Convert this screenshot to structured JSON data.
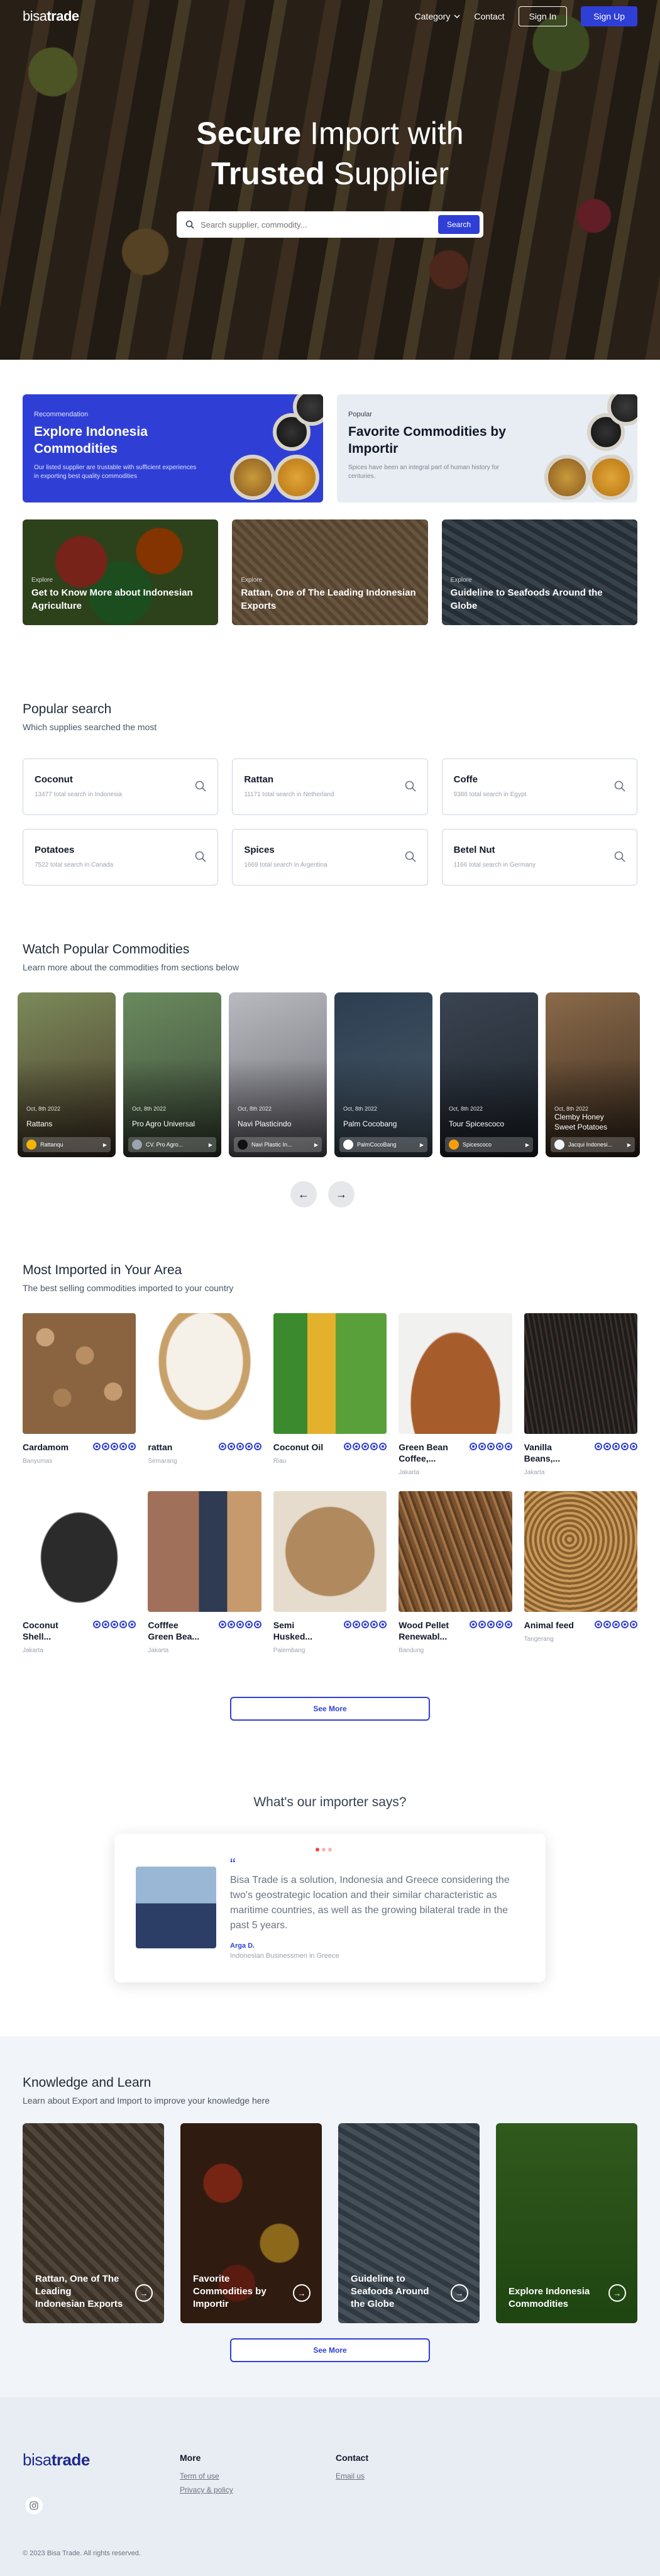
{
  "nav": {
    "logo_part1": "bisa",
    "logo_part2": "trade",
    "category": "Category",
    "contact": "Contact",
    "sign_in": "Sign In",
    "sign_up": "Sign Up"
  },
  "hero": {
    "title_bold1": "Secure",
    "title_rest1": " Import with",
    "title_bold2": "Trusted",
    "title_rest2": " Supplier",
    "search_placeholder": "Search supplier, commodity...",
    "search_button": "Search"
  },
  "promo": [
    {
      "tag": "Recommendation",
      "title": "Explore Indonesia Commodities",
      "desc": "Our listed supplier are trustable with sufficient experiences in exporting best quality commodities"
    },
    {
      "tag": "Popular",
      "title": "Favorite Commodities by Importir",
      "desc": "Spices have been an integral part of human history for centuries."
    }
  ],
  "explore": [
    {
      "label": "Explore",
      "title": "Get to Know More about Indonesian Agriculture"
    },
    {
      "label": "Explore",
      "title": "Rattan, One of The Leading Indonesian Exports"
    },
    {
      "label": "Explore",
      "title": "Guideline to Seafoods Around the Globe"
    }
  ],
  "popular_search": {
    "title": "Popular search",
    "subtitle": "Which supplies searched the most",
    "items": [
      {
        "name": "Coconut",
        "meta": "13477 total search in Indonesia"
      },
      {
        "name": "Rattan",
        "meta": "11171 total search in Netherland"
      },
      {
        "name": "Coffe",
        "meta": "9386 total search in Egypt"
      },
      {
        "name": "Potatoes",
        "meta": "7522 total search in Canada"
      },
      {
        "name": "Spices",
        "meta": "1669 total search in Argentina"
      },
      {
        "name": "Betel Nut",
        "meta": "1166 total search in Germany"
      }
    ]
  },
  "watch": {
    "title": "Watch Popular Commodities",
    "subtitle": "Learn more about the commodities from sections below",
    "videos": [
      {
        "date": "Oct, 8th 2022",
        "name": "Rattans",
        "user": "Rattanqu"
      },
      {
        "date": "Oct, 8th 2022",
        "name": "Pro Agro Universal",
        "user": "CV. Pro Agro..."
      },
      {
        "date": "Oct, 8th 2022",
        "name": "Navi Plasticindo",
        "user": "Navi Plastic In..."
      },
      {
        "date": "Oct, 8th 2022",
        "name": "Palm Cocobang",
        "user": "PalmCocoBang"
      },
      {
        "date": "Oct, 8th 2022",
        "name": "Tour Spicescoco",
        "user": "Spicescoco"
      },
      {
        "date": "Oct, 8th 2022",
        "name": "Clemby Honey Sweet Potatoes",
        "user": "Jacqui Indonesi..."
      }
    ]
  },
  "most": {
    "title": "Most Imported in Your Area",
    "subtitle": "The best selling commodities imported to your country",
    "products": [
      {
        "name": "Cardamom",
        "loc": "Banyumas"
      },
      {
        "name": "rattan",
        "loc": "Semarang"
      },
      {
        "name": "Coconut Oil",
        "loc": "Riau"
      },
      {
        "name": "Green Bean Coffee,...",
        "loc": "Jakarta"
      },
      {
        "name": "Vanilla Beans,...",
        "loc": "Jakarta"
      },
      {
        "name": "Coconut Shell...",
        "loc": "Jakarta"
      },
      {
        "name": "Cofffee Green Bea...",
        "loc": "Jakarta"
      },
      {
        "name": "Semi Husked...",
        "loc": "Palembang"
      },
      {
        "name": "Wood Pellet Renewabl...",
        "loc": "Bandung"
      },
      {
        "name": "Animal feed",
        "loc": "Tangerang"
      }
    ],
    "see_more": "See More"
  },
  "testimonial": {
    "title": "What's our importer says?",
    "quote_mark": "“",
    "text": "Bisa Trade is a solution, Indonesia and Greece considering the two's geostrategic location and their similar characteristic as maritime countries, as well as the growing bilateral trade in the past 5 years.",
    "name": "Arga D.",
    "role": "Indonesian Businessmen in Greece"
  },
  "knowledge": {
    "title": "Knowledge and Learn",
    "subtitle": "Learn about Export and Import to improve your knowledge here",
    "cards": [
      {
        "title": "Rattan, One of The Leading Indonesian Exports"
      },
      {
        "title": "Favorite Commodities by Importir"
      },
      {
        "title": "Guideline to Seafoods Around the Globe"
      },
      {
        "title": "Explore Indonesia Commodities"
      }
    ],
    "see_more": "See More"
  },
  "footer": {
    "logo_part1": "bisa",
    "logo_part2": "trade",
    "more": "More",
    "terms": "Term of use",
    "privacy": "Privacy & policy",
    "contact": "Contact",
    "email": "Email us",
    "copyright": "© 2023 Bisa Trade. All rights reserved."
  },
  "colors": {
    "primary": "#2f3fd6",
    "footer_bg": "#e8edf3",
    "star": "#2f3fd6"
  }
}
